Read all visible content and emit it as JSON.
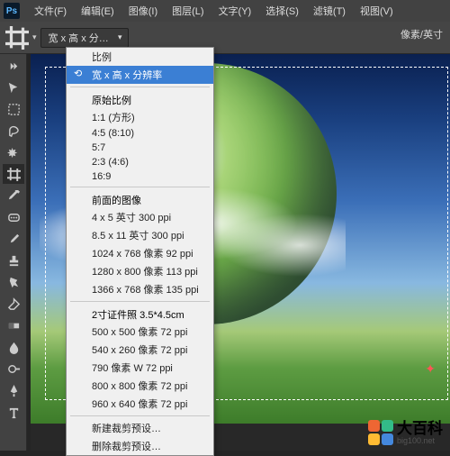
{
  "app": {
    "logo": "Ps"
  },
  "menubar": [
    {
      "label": "文件(F)"
    },
    {
      "label": "编辑(E)"
    },
    {
      "label": "图像(I)"
    },
    {
      "label": "图层(L)"
    },
    {
      "label": "文字(Y)"
    },
    {
      "label": "选择(S)"
    },
    {
      "label": "滤镜(T)"
    },
    {
      "label": "视图(V)"
    }
  ],
  "toolbar": {
    "crop_dropdown_value": "宽 x 高 x 分…",
    "right_label": "像素/英寸"
  },
  "crop_presets": {
    "ratio": "比例",
    "highlighted": "宽 x 高 x 分辨率",
    "original_header": "原始比例",
    "originals": [
      "1:1 (方形)",
      "4:5 (8:10)",
      "5:7",
      "2:3 (4:6)",
      "16:9"
    ],
    "prev_header": "前面的图像",
    "prev": [
      "4 x 5 英寸  300 ppi",
      "8.5 x 11 英寸  300 ppi",
      "1024 x 768 像素  92 ppi",
      "1280 x 800 像素  113 ppi",
      "1366 x 768 像素  135 ppi"
    ],
    "cert_header": "2寸证件照 3.5*4.5cm",
    "cert": [
      "500 x 500 像素 72 ppi",
      "540 x 260 像素 72 ppi",
      "790 像素 W 72 ppi",
      "800 x 800 像素 72 ppi",
      "960 x 640 像素 72 ppi"
    ],
    "new_preset": "新建裁剪预设…",
    "delete_preset": "删除裁剪预设…"
  },
  "watermark": {
    "text": "大百科",
    "url": "big100.net"
  }
}
